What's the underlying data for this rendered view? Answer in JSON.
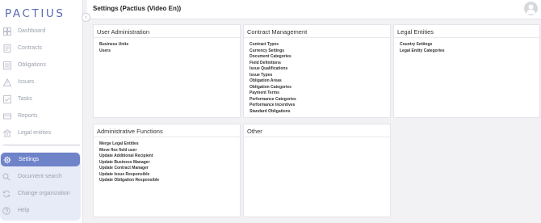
{
  "app": {
    "logo": "PACTIUS"
  },
  "header": {
    "title": "Settings (Pactius (Video En))"
  },
  "sidebar": {
    "items": [
      {
        "label": "Dashboard",
        "icon": "dashboard-icon"
      },
      {
        "label": "Contracts",
        "icon": "contract-icon"
      },
      {
        "label": "Obligations",
        "icon": "obligations-icon"
      },
      {
        "label": "Issues",
        "icon": "warning-icon"
      },
      {
        "label": "Tasks",
        "icon": "tasks-icon"
      },
      {
        "label": "Reports",
        "icon": "reports-icon"
      },
      {
        "label": "Legal entities",
        "icon": "bank-icon"
      }
    ],
    "active": {
      "label": "Settings",
      "icon": "gear-icon"
    },
    "lower_items": [
      {
        "label": "Document search",
        "icon": "search-icon"
      },
      {
        "label": "Change organization",
        "icon": "switch-icon"
      },
      {
        "label": "Help",
        "icon": "help-icon"
      }
    ]
  },
  "cards": {
    "user_admin": {
      "title": "User Administration",
      "links": [
        "Business Units",
        "Users"
      ]
    },
    "contract_mgmt": {
      "title": "Contract Management",
      "links": [
        "Contract Types",
        "Currency Settings",
        "Document Categories",
        "Field Definitions",
        "Issue Qualifications",
        "Issue Types",
        "Obligation Areas",
        "Obligation Categories",
        "Payment Terms",
        "Performance Categories",
        "Performance Incentives",
        "Standard Obligations"
      ]
    },
    "legal_entities": {
      "title": "Legal Entities",
      "links": [
        "Country Settings",
        "Legal Entity Categories"
      ]
    },
    "admin_functions": {
      "title": "Administrative Functions",
      "links": [
        "Merge Legal Entities",
        "Move flex field user",
        "Update Additional Recipient",
        "Update Business Manager",
        "Update Contract Manager",
        "Update Issue Responsible",
        "Update Obligation Responsible"
      ]
    },
    "other": {
      "title": "Other",
      "links": []
    }
  },
  "colors": {
    "accent": "#6f83c9",
    "logo": "#5b6bb5",
    "active_bg": "#e7ebf7"
  }
}
